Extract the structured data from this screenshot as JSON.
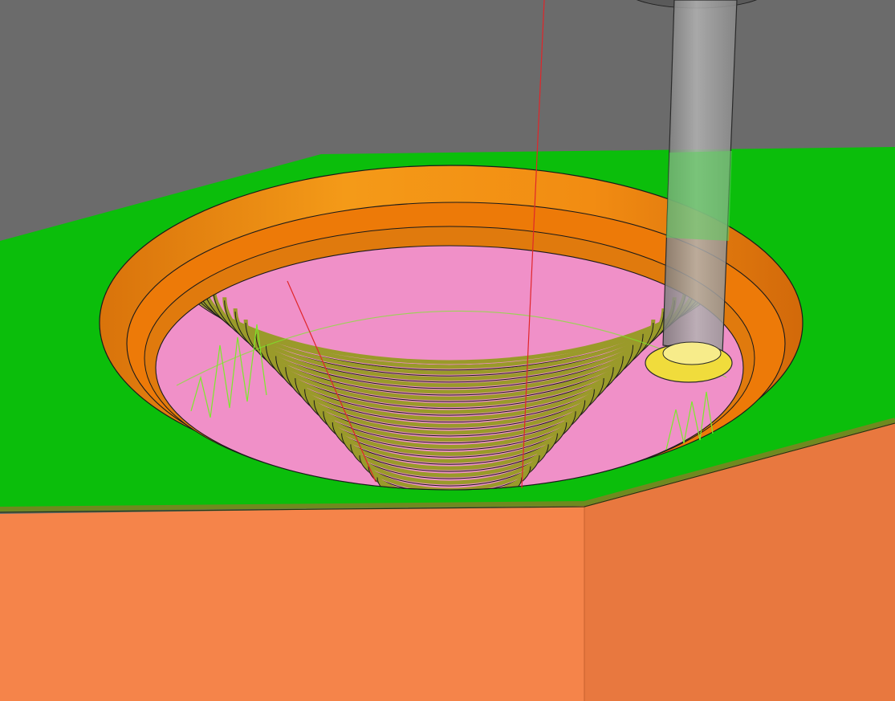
{
  "scene": {
    "colors": {
      "background": "#6b6b6b",
      "top_face": "#0bbe0b",
      "top_face_edge": "#6f8a1f",
      "front_face": "#f5844a",
      "right_face": "#e8783f",
      "pocket_wall": "#f28c12",
      "pocket_wall_dark": "#d96f0a",
      "pocket_floor": "#ed7a08",
      "cone_surface": "#f090c8",
      "cone_groove": "#9a9a2a",
      "cone_line": "#1a1a1a",
      "toolpath": "#7bea2b",
      "axis_line": "#e0262a",
      "tool_shank": "#a9a9a9",
      "tool_tip": "#f0dc3c"
    },
    "cone_band_count": 22,
    "icons": [
      "workpiece",
      "milling-tool",
      "toolpath",
      "spiral-groove"
    ]
  }
}
